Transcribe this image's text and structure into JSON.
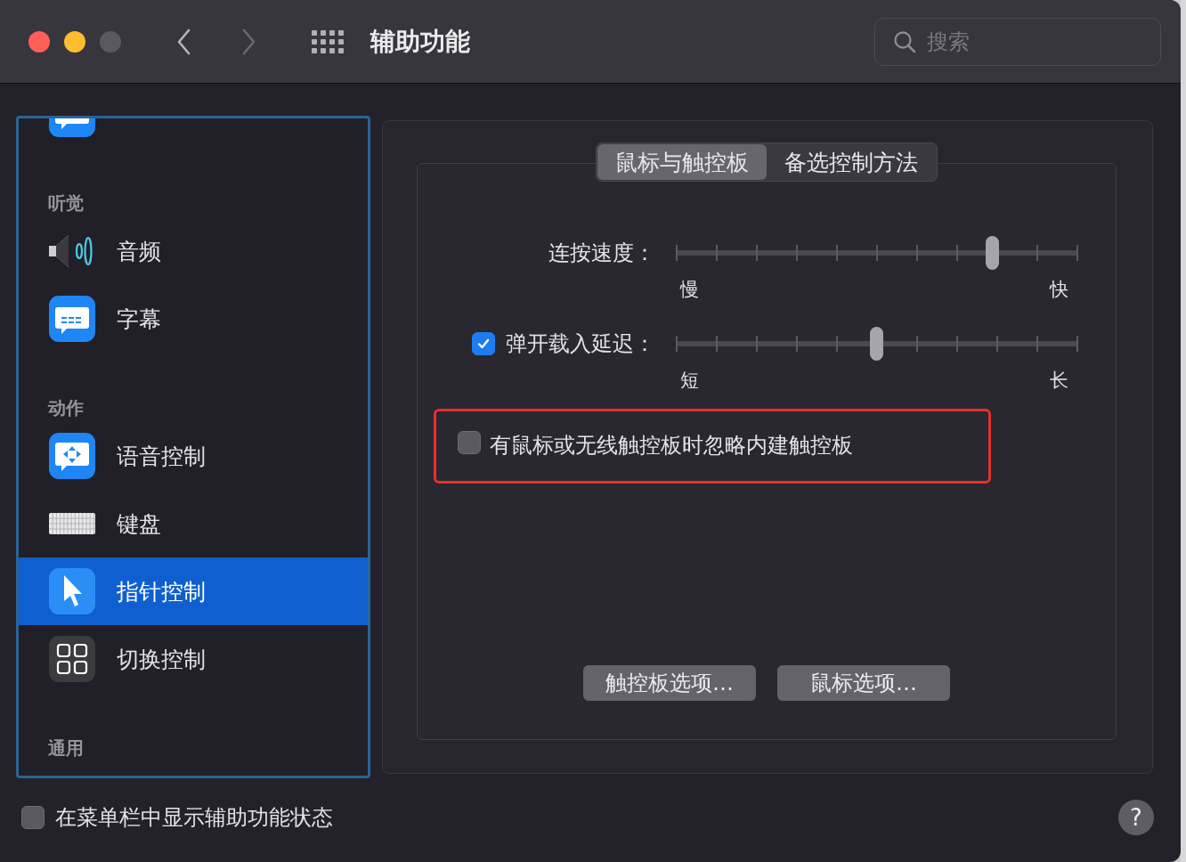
{
  "window": {
    "title": "辅助功能",
    "controls": [
      {
        "kind": "close",
        "disabled": false
      },
      {
        "kind": "minimize",
        "disabled": false
      },
      {
        "kind": "zoom",
        "disabled": true
      }
    ]
  },
  "nav": [
    {
      "kind": "back",
      "disabled": false
    },
    {
      "kind": "forward",
      "disabled": true
    }
  ],
  "search": {
    "placeholder": "搜索"
  },
  "sidebar": [
    {
      "kind": "description",
      "selected": false
    },
    {
      "kind": "header",
      "label": "听觉"
    },
    {
      "kind": "audio",
      "label": "音频",
      "selected": false
    },
    {
      "kind": "captions",
      "label": "字幕",
      "selected": false
    },
    {
      "kind": "header",
      "label": "动作"
    },
    {
      "kind": "voice",
      "label": "语音控制",
      "selected": false
    },
    {
      "kind": "keyboard",
      "label": "键盘",
      "selected": false
    },
    {
      "kind": "pointer",
      "label": "指针控制",
      "selected": true
    },
    {
      "kind": "switch",
      "label": "切换控制",
      "selected": false
    },
    {
      "kind": "header",
      "label": "通用"
    }
  ],
  "tabs": [
    {
      "label": "鼠标与触控板",
      "selected": true
    },
    {
      "label": "备选控制方法",
      "selected": false
    }
  ],
  "sliders": [
    {
      "label": "连按速度：",
      "level": 0.787,
      "min_label": "慢",
      "max_label": "快"
    },
    {
      "label": "弹开载入延迟：",
      "checked": true,
      "level": 0.498,
      "min_label": "短",
      "max_label": "长"
    }
  ],
  "option": {
    "label": "有鼠标或无线触控板时忽略内建触控板",
    "checked": false,
    "highlighted": true
  },
  "buttons": [
    "触控板选项…",
    "鼠标选项…"
  ],
  "footer": {
    "label": "在菜单栏中显示辅助功能状态",
    "checked": false,
    "help": "?"
  }
}
